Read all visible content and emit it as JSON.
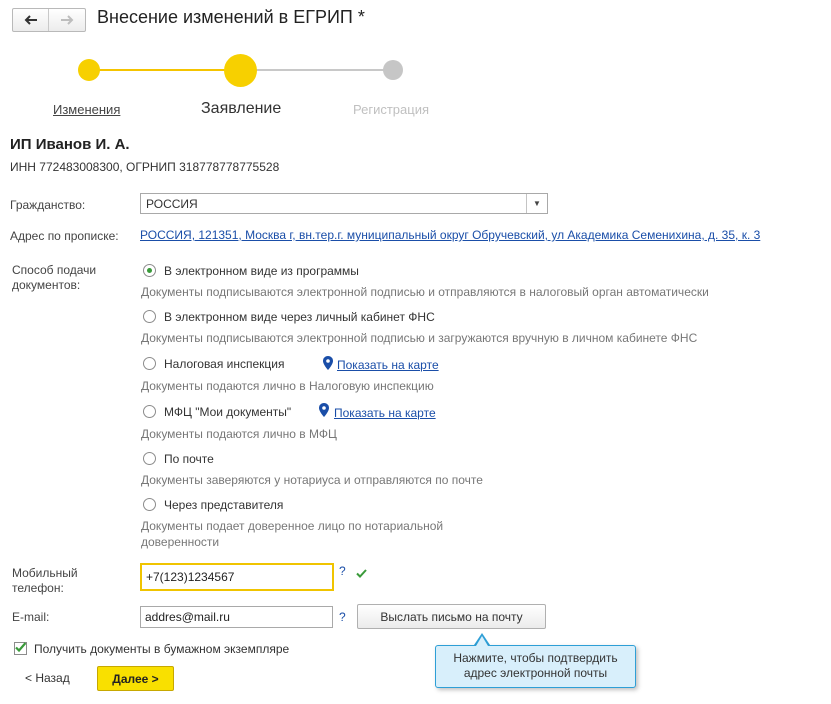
{
  "header": {
    "title": "Внесение изменений в ЕГРИП *"
  },
  "stepper": {
    "steps": [
      "Изменения",
      "Заявление",
      "Регистрация"
    ]
  },
  "entrepreneur": {
    "name": "ИП Иванов И. А.",
    "ids": "ИНН 772483008300, ОГРНИП 318778778775528"
  },
  "form": {
    "citizenship_label": "Гражданство:",
    "citizenship_value": "РОССИЯ",
    "address_label": "Адрес по прописке:",
    "address_value": "РОССИЯ, 121351, Москва г, вн.тер.г. муниципальный округ Обручевский, ул Академика Семенихина, д. 35, к. 3",
    "submission_label_1": "Способ подачи",
    "submission_label_2": "документов:",
    "options": [
      {
        "label": "В электронном виде из программы",
        "desc": "Документы подписываются электронной подписью и отправляются в налоговый орган автоматически",
        "selected": true
      },
      {
        "label": "В электронном виде через личный кабинет ФНС",
        "desc": "Документы подписываются электронной подписью и загружаются вручную в личном кабинете ФНС",
        "selected": false
      },
      {
        "label": "Налоговая инспекция",
        "desc": "Документы подаются лично в Налоговую инспекцию",
        "map_link": "Показать на карте",
        "selected": false
      },
      {
        "label": "МФЦ \"Мои документы\"",
        "desc": "Документы подаются лично в МФЦ",
        "map_link": "Показать на карте",
        "selected": false
      },
      {
        "label": "По почте",
        "desc": "Документы заверяются у нотариуса и отправляются по почте",
        "selected": false
      },
      {
        "label": "Через представителя",
        "desc_1": "Документы подает доверенное лицо по нотариальной",
        "desc_2": "доверенности",
        "selected": false
      }
    ],
    "phone_label_1": "Мобильный",
    "phone_label_2": "телефон:",
    "phone_value": "+7(123)1234567",
    "help_mark": "?",
    "email_label": "E-mail:",
    "email_value": "addres@mail.ru",
    "send_button": "Выслать письмо на почту",
    "paper_copy_label": "Получить документы в бумажном экземпляре",
    "paper_copy_checked": true
  },
  "footer": {
    "back_label": "< Назад",
    "next_label": "Далее >"
  },
  "tooltip": {
    "line1": "Нажмите, чтобы подтвердить",
    "line2": "адрес электронной почты"
  },
  "colors": {
    "accent_yellow": "#f7d000",
    "link_blue": "#1a4ea8",
    "check_green": "#3a9a3a",
    "tooltip_bg": "#d8effb"
  }
}
